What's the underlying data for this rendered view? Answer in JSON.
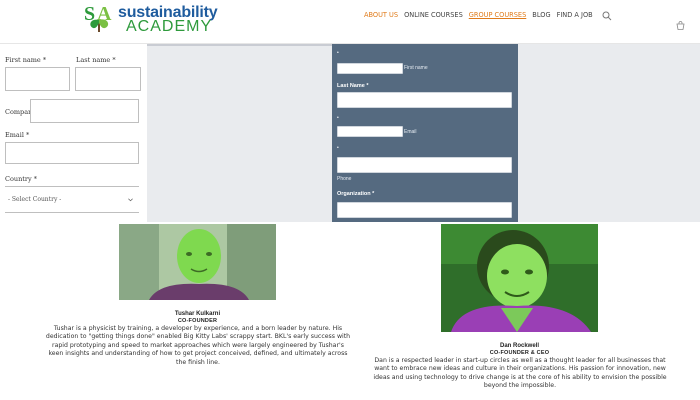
{
  "header": {
    "logo_line1": "sustainability",
    "logo_line2": "ACADEMY",
    "nav": [
      {
        "label": "ABOUT US",
        "state": "active"
      },
      {
        "label": "ONLINE COURSES",
        "state": "normal"
      },
      {
        "label": "GROUP COURSES",
        "state": "highlight"
      },
      {
        "label": "BLOG",
        "state": "normal"
      },
      {
        "label": "FIND A JOB",
        "state": "normal"
      }
    ],
    "search_icon": "search-icon",
    "cart_icon": "cart-icon"
  },
  "left_form": {
    "first_name_label": "First name *",
    "last_name_label": "Last name *",
    "company_label": "Company *",
    "email_label": "Email *",
    "country_label": "Country *",
    "country_selected": "- Select Country -"
  },
  "dark_form": {
    "first_name_sublabel": "First name",
    "last_name_label": "Last Name *",
    "email_sublabel": "Email",
    "phone_sublabel": "Phone",
    "organization_label": "Organization *"
  },
  "people": [
    {
      "name": "Tushar Kulkarni",
      "title": "CO-FOUNDER",
      "bio": "Tushar is a physicist by training, a developer by experience, and a born leader by nature. His dedication to \"getting things done\" enabled Big Kitty Labs' scrappy start. BKL's early success with rapid prototyping and speed to market approaches which were largely engineered by Tushar's keen insights and understanding of how to get project conceived, defined, and ultimately across the finish line."
    },
    {
      "name": "Dan Rockwell",
      "title": "CO-FOUNDER & CEO",
      "bio": "Dan is a respected leader in start-up circles as well as a thought leader for all businesses that want to embrace new ideas and culture in their organizations. His passion for innovation, new ideas and using technology to drive change is at the core of his ability to envision the possible beyond the impossible."
    }
  ],
  "colors": {
    "brand_blue": "#1f5c9e",
    "brand_green": "#2e9a3c",
    "nav_accent": "#e07b1a",
    "form_panel": "#556a80",
    "photo_tint": "#8ee060"
  }
}
